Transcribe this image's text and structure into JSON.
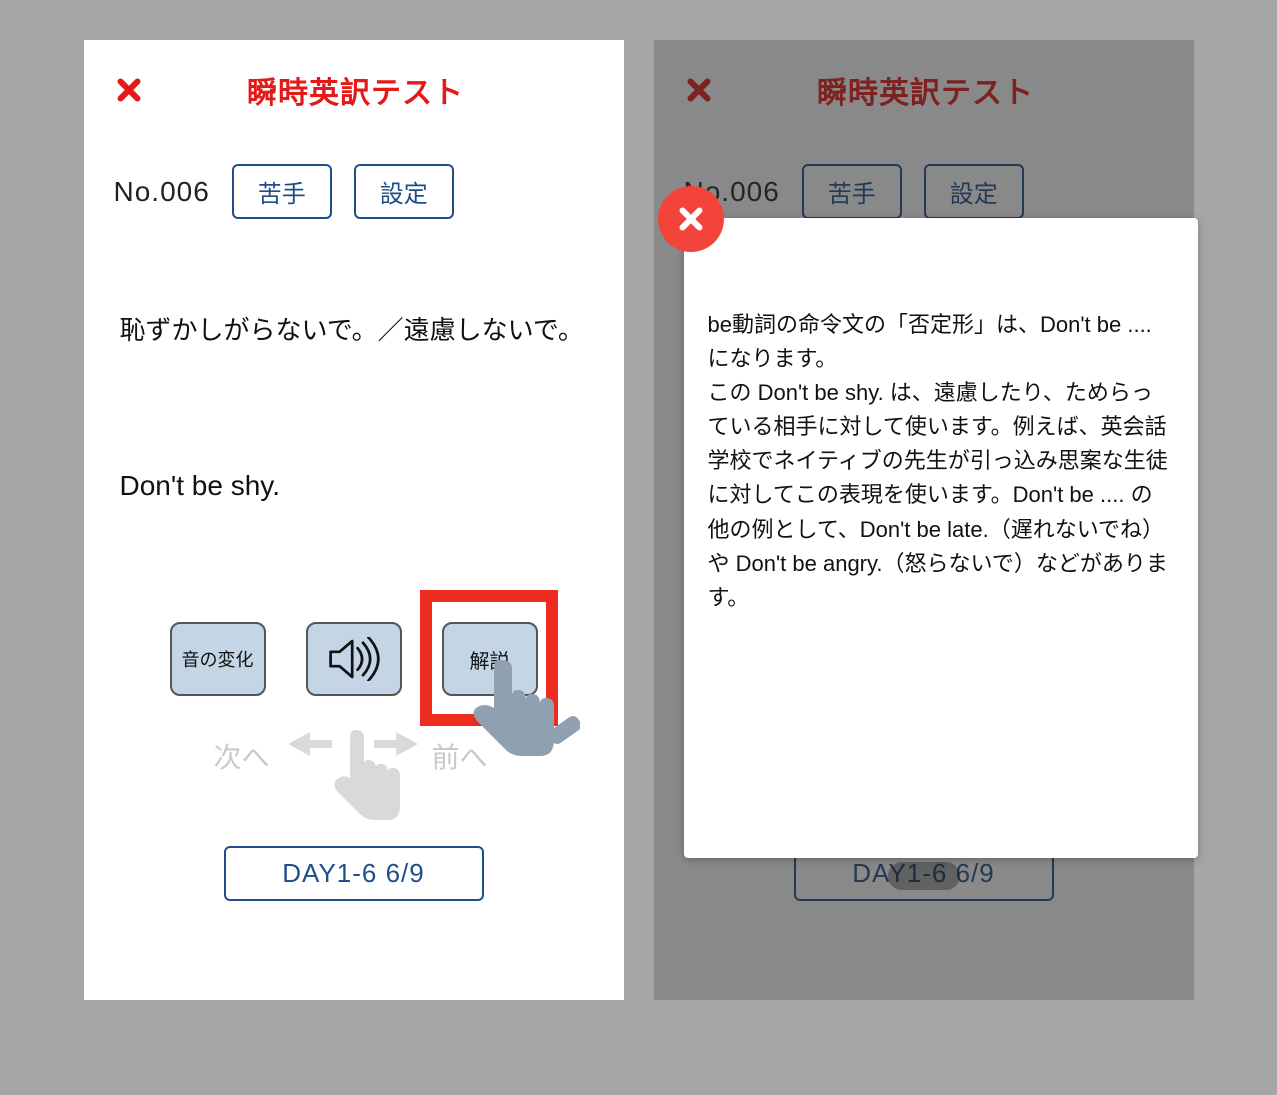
{
  "header": {
    "title": "瞬時英訳テスト"
  },
  "question": {
    "no_label": "No.006",
    "chip_weak": "苦手",
    "chip_settings": "設定",
    "jp": "恥ずかしがらないで。／遠慮しないで。",
    "en": "Don't be shy."
  },
  "actions": {
    "sound_change": "音の変化",
    "explain": "解説"
  },
  "swipe": {
    "next": "次へ",
    "prev": "前へ"
  },
  "progress": "DAY1-6  6/9",
  "popup": {
    "text": "be動詞の命令文の「否定形」は、Don't be .... になります。\nこの Don't be shy. は、遠慮したり、ためらっている相手に対して使います。例えば、英会話学校でネイティブの先生が引っ込み思案な生徒に対してこの表現を使います。Don't be .... の他の例として、Don't be late.（遅れないでね）や Don't be angry.（怒らないで）などがあります。"
  },
  "colors": {
    "accent_red": "#e61919",
    "outline_blue": "#1e4f8b",
    "tile_fill": "#c4d5e6",
    "pointer_gray": "#8fa0b0"
  }
}
